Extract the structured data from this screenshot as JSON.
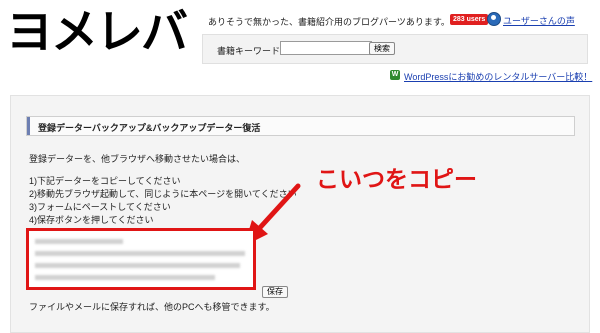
{
  "header": {
    "logo_text": "ヨメレバ",
    "tagline": "ありそうで無かった、書籍紹介用のブログパーツあります。",
    "users_badge": "283 users",
    "voice_link": "ユーザーさんの声",
    "voice_icon": "user-bubble-icon"
  },
  "search": {
    "label": "書籍キーワード:",
    "input_value": "",
    "button_label": "検索"
  },
  "ad": {
    "icon": "wordpress-icon",
    "icon_text": "W",
    "link_text": "WordPressにお勧めのレンタルサーバー比較！"
  },
  "section": {
    "title": "登録データーバックアップ&バックアップデーター復活",
    "intro": "登録データーを、他ブラウザへ移動させたい場合は、",
    "steps": [
      "1)下記データーをコピーしてください",
      "2)移動先ブラウザ起動して、同じように本ページを開いてください",
      "3)フォームにペーストしてください",
      "4)保存ボタンを押してください"
    ],
    "save_button": "保存",
    "footer_note": "ファイルやメールに保存すれば、他のPCへも移管できます。"
  },
  "annotation": {
    "text": "こいつをコピー",
    "color": "#e01515"
  },
  "colors": {
    "link": "#1a3fb0",
    "badge": "#e02020",
    "accent_bar": "#6d7fb2"
  }
}
